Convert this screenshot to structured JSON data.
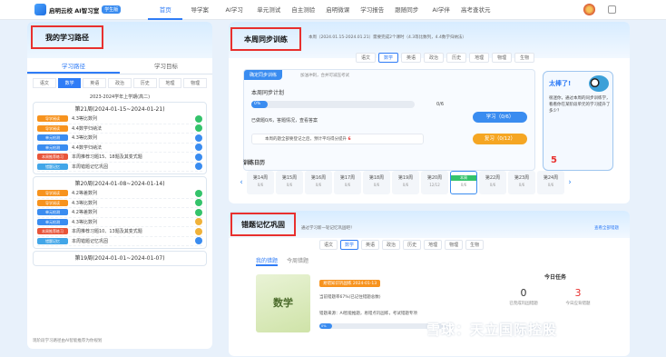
{
  "topbar": {
    "logo_text": "启明云校 AI智习室",
    "logo_badge": "学生版",
    "nav": [
      "首页",
      "导学案",
      "AI学习",
      "单元测试",
      "自主测验",
      "启明微课",
      "学习报告",
      "跟随同步",
      "AI学伴",
      "高考查状元"
    ],
    "active_index": 0
  },
  "left": {
    "title": "我的学习路径",
    "tabs": [
      "学习路径",
      "学习目标"
    ],
    "subjects": [
      "语文",
      "数学",
      "英语",
      "政治",
      "历史",
      "地理",
      "物理"
    ],
    "active_subject": 1,
    "term": "2023-2024学年上学期(高二)",
    "weeks": [
      {
        "title": "第21周(2024-01-15~2024-01-21)",
        "rows": [
          {
            "tag": "导学阅读",
            "tc": "o",
            "text": "4.3等比数列",
            "st": "g"
          },
          {
            "tag": "导学阅读",
            "tc": "o",
            "text": "4.4数学归纳法",
            "st": "g"
          },
          {
            "tag": "单元检测",
            "tc": "b",
            "text": "4.3等比数列",
            "st": "bl"
          },
          {
            "tag": "单元检测",
            "tc": "b",
            "text": "4.4数学归纳法",
            "st": "bl"
          },
          {
            "tag": "本周推荐练习",
            "tc": "r",
            "text": "本周推荐习题15、18题及其变式题",
            "st": "bl"
          },
          {
            "tag": "错题记忆",
            "tc": "c",
            "text": "本周错题记忆巩固",
            "st": "bl"
          }
        ]
      },
      {
        "title": "第20周(2024-01-08~2024-01-14)",
        "rows": [
          {
            "tag": "导学阅读",
            "tc": "o",
            "text": "4.2等差数列",
            "st": "g"
          },
          {
            "tag": "导学阅读",
            "tc": "o",
            "text": "4.3等比数列",
            "st": "g"
          },
          {
            "tag": "单元检测",
            "tc": "b",
            "text": "4.2等差数列",
            "st": "g"
          },
          {
            "tag": "单元检测",
            "tc": "b",
            "text": "4.3等比数列",
            "st": "y"
          },
          {
            "tag": "本周推荐练习",
            "tc": "r",
            "text": "本周推荐习题10、13题及其变式题",
            "st": "y"
          },
          {
            "tag": "错题记忆",
            "tc": "c",
            "text": "本周错题记忆巩固",
            "st": "bl"
          }
        ]
      },
      {
        "title": "第19周(2024-01-01~2024-01-07)",
        "rows": []
      }
    ],
    "footer": "现阶段学习路径由AI智能推荐为你规划"
  },
  "mid": {
    "title": "本周同步训练",
    "subtitle": "本周（2024.01.15-2024.01.21）需要完成2个课时（4.3等比数列，4.4数学归纳法）",
    "subjects": [
      "语文",
      "数学",
      "英语",
      "政治",
      "历史",
      "地理",
      "物理",
      "生物"
    ],
    "active_subject": 1,
    "plan_tag": "确定同步训练",
    "plan_tip": "加油冲刺，合并可减压考试",
    "plan_title": "本周同步计划",
    "progress_label": "0%",
    "progress_count": "0/6",
    "plan_line": "已做题0/6，答题情况，查看答案",
    "warn_prefix": "本周的题全部要登记之后，预计平均得分提升",
    "warn_num": "6",
    "btn_learn": "学习（0/6）",
    "btn_review": "复习（0/12）",
    "award_title": "太棒了!",
    "award_text": "很迷你，通过本周的同步训练学，看看你在某阶段单元的学习提升了多少？",
    "award_num": "5",
    "cal_title": "训练日历",
    "cal": [
      {
        "w": "第14周",
        "v": "0/6"
      },
      {
        "w": "第15周",
        "v": "0/6"
      },
      {
        "w": "第16周",
        "v": "0/6"
      },
      {
        "w": "第17周",
        "v": "0/6"
      },
      {
        "w": "第18周",
        "v": "0/6"
      },
      {
        "w": "第19周",
        "v": "0/6"
      },
      {
        "w": "第20周",
        "v": "12/12"
      },
      {
        "w": "本周",
        "v": "0/6"
      },
      {
        "w": "第22周",
        "v": "0/6"
      },
      {
        "w": "第23周",
        "v": "0/6"
      },
      {
        "w": "第24周",
        "v": "0/6"
      }
    ]
  },
  "bottom": {
    "title": "错题记忆巩固",
    "subtitle": "通过学习新一轮记忆巩固吧！",
    "link": "查看全部错题",
    "subjects": [
      "语文",
      "数学",
      "英语",
      "政治",
      "历史",
      "地理",
      "物理",
      "生物"
    ],
    "active_subject": 1,
    "tabs": [
      "我的错题",
      "今周错题"
    ],
    "book": "数学",
    "task_tag": "易错知识巩固练 2024-01-13",
    "task_line1": "当前错题率67%(已记住错题总数)",
    "task_line2": "错题来源：AI智能推题，易错点巩固练，考试错题专项",
    "task_prog": "0%",
    "today_title": "今日任务",
    "stat1": "0",
    "stat1_label": "已完成巩固错题",
    "stat2": "3",
    "stat2_label": "今日应背错题"
  },
  "watermark": "雪球：天立国际控股"
}
